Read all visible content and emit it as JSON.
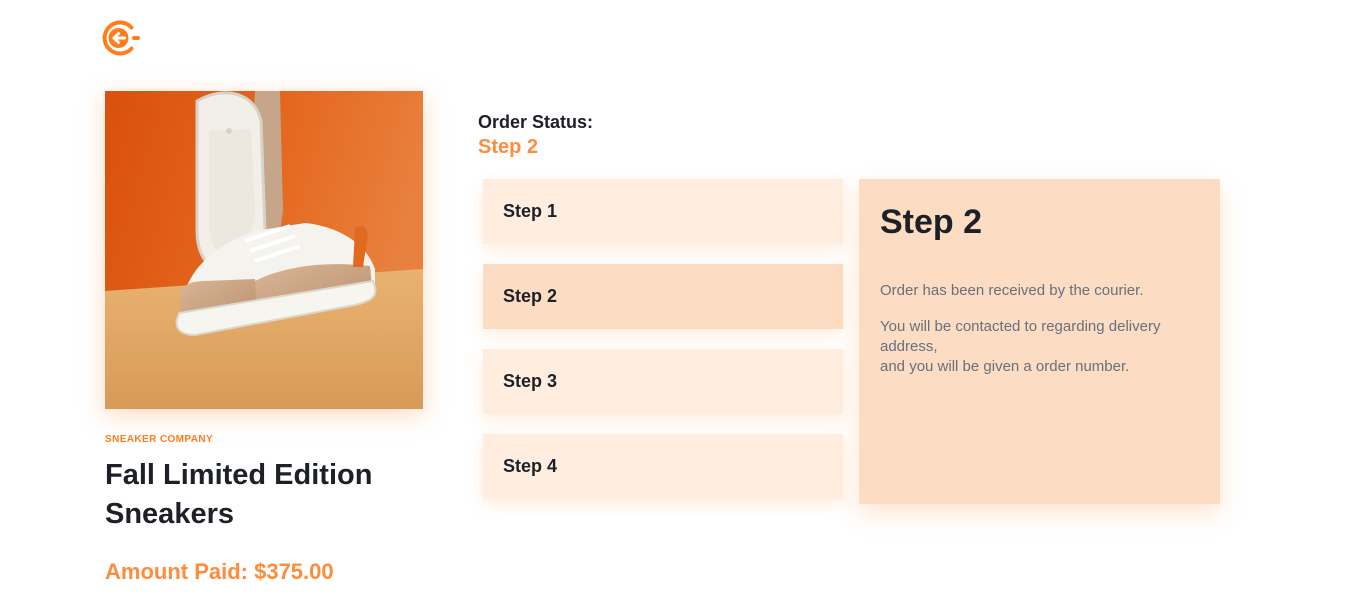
{
  "header": {
    "back_icon": "arrow-left-circle-icon"
  },
  "product": {
    "company": "SNEAKER COMPANY",
    "title": "Fall Limited Edition Sneakers",
    "amount_paid": "Amount Paid: $375.00",
    "image_icon": "sneaker-photo"
  },
  "order_status": {
    "label": "Order Status:",
    "current": "Step 2"
  },
  "steps": [
    {
      "label": "Step 1",
      "active": false
    },
    {
      "label": "Step 2",
      "active": true
    },
    {
      "label": "Step 3",
      "active": false
    },
    {
      "label": "Step 4",
      "active": false
    }
  ],
  "detail": {
    "title": "Step 2",
    "line1": "Order has been received by the courier.",
    "line2a": "You will be contacted to regarding delivery address,",
    "line2b": "and you will be given a order number."
  },
  "colors": {
    "accent": "#ff7e1b",
    "accent_text": "#ff8c3a",
    "step_bg": "#ffeee0",
    "step_active_bg": "#fcdcc2",
    "dark_text": "#1d2026",
    "muted_text": "#68707d"
  }
}
